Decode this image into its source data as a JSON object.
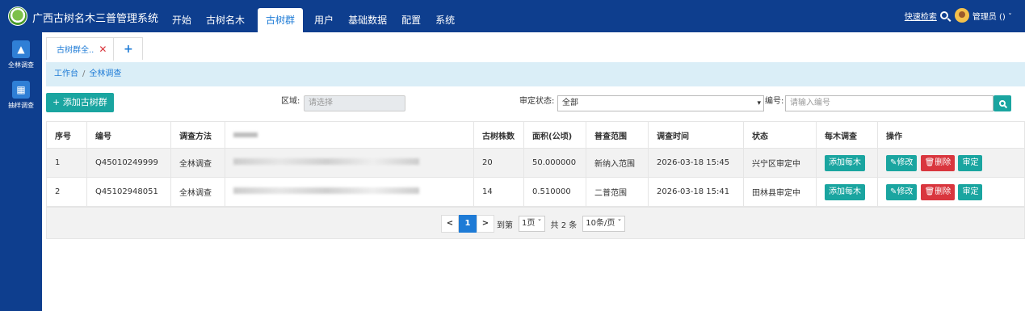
{
  "app": {
    "title": "广西古树名木三普管理系统"
  },
  "nav": [
    "开始",
    "古树名木",
    "古树群",
    "用户",
    "基础数据",
    "配置",
    "系统"
  ],
  "topright": {
    "quick_search": "快速检索",
    "user": "管理员 () ˇ"
  },
  "sidebar": [
    {
      "label": "全林调查",
      "icon": "tree-icon"
    },
    {
      "label": "抽样调查",
      "icon": "grid-icon"
    }
  ],
  "tabs": [
    {
      "label": "古树群全.."
    }
  ],
  "breadcrumb": {
    "root": "工作台",
    "sep": "/",
    "current": "全林调查"
  },
  "toolbar": {
    "add_label": "+ 添加古树群",
    "region_label": "区域:",
    "region_placeholder": "请选择",
    "status_label": "审定状态:",
    "status_value": "全部",
    "code_label": "编号:",
    "code_placeholder": "请输入编号"
  },
  "table": {
    "headers": [
      "序号",
      "编号",
      "调查方法",
      "",
      "古树株数",
      "面积(公顷)",
      "普查范围",
      "调查时间",
      "状态",
      "每木调查",
      "操作"
    ],
    "rows": [
      {
        "idx": "1",
        "code": "Q45010249999",
        "method": "全林调查",
        "count": "20",
        "area": "50.000000",
        "scope": "新纳入范围",
        "time": "2026-03-18 15:45",
        "status": "兴宁区审定中"
      },
      {
        "idx": "2",
        "code": "Q45102948051",
        "method": "全林调查",
        "count": "14",
        "area": "0.510000",
        "scope": "二普范围",
        "time": "2026-03-18 15:41",
        "status": "田林县审定中"
      }
    ],
    "row_actions": {
      "add_tree": "添加每木",
      "edit": "✎修改",
      "delete": "🗑删除",
      "review": "审定"
    }
  },
  "pager": {
    "prev": "<",
    "current": "1",
    "next": ">",
    "goto": "到第",
    "page_select": "1页 ˇ",
    "total": "共 2 条",
    "size_select": "10条/页 ˇ"
  },
  "colors": {
    "navy": "#0e3e8e",
    "teal": "#1aa5a0",
    "blue": "#1e7bd6",
    "red": "#d9363e",
    "orange": "#f08a24"
  }
}
